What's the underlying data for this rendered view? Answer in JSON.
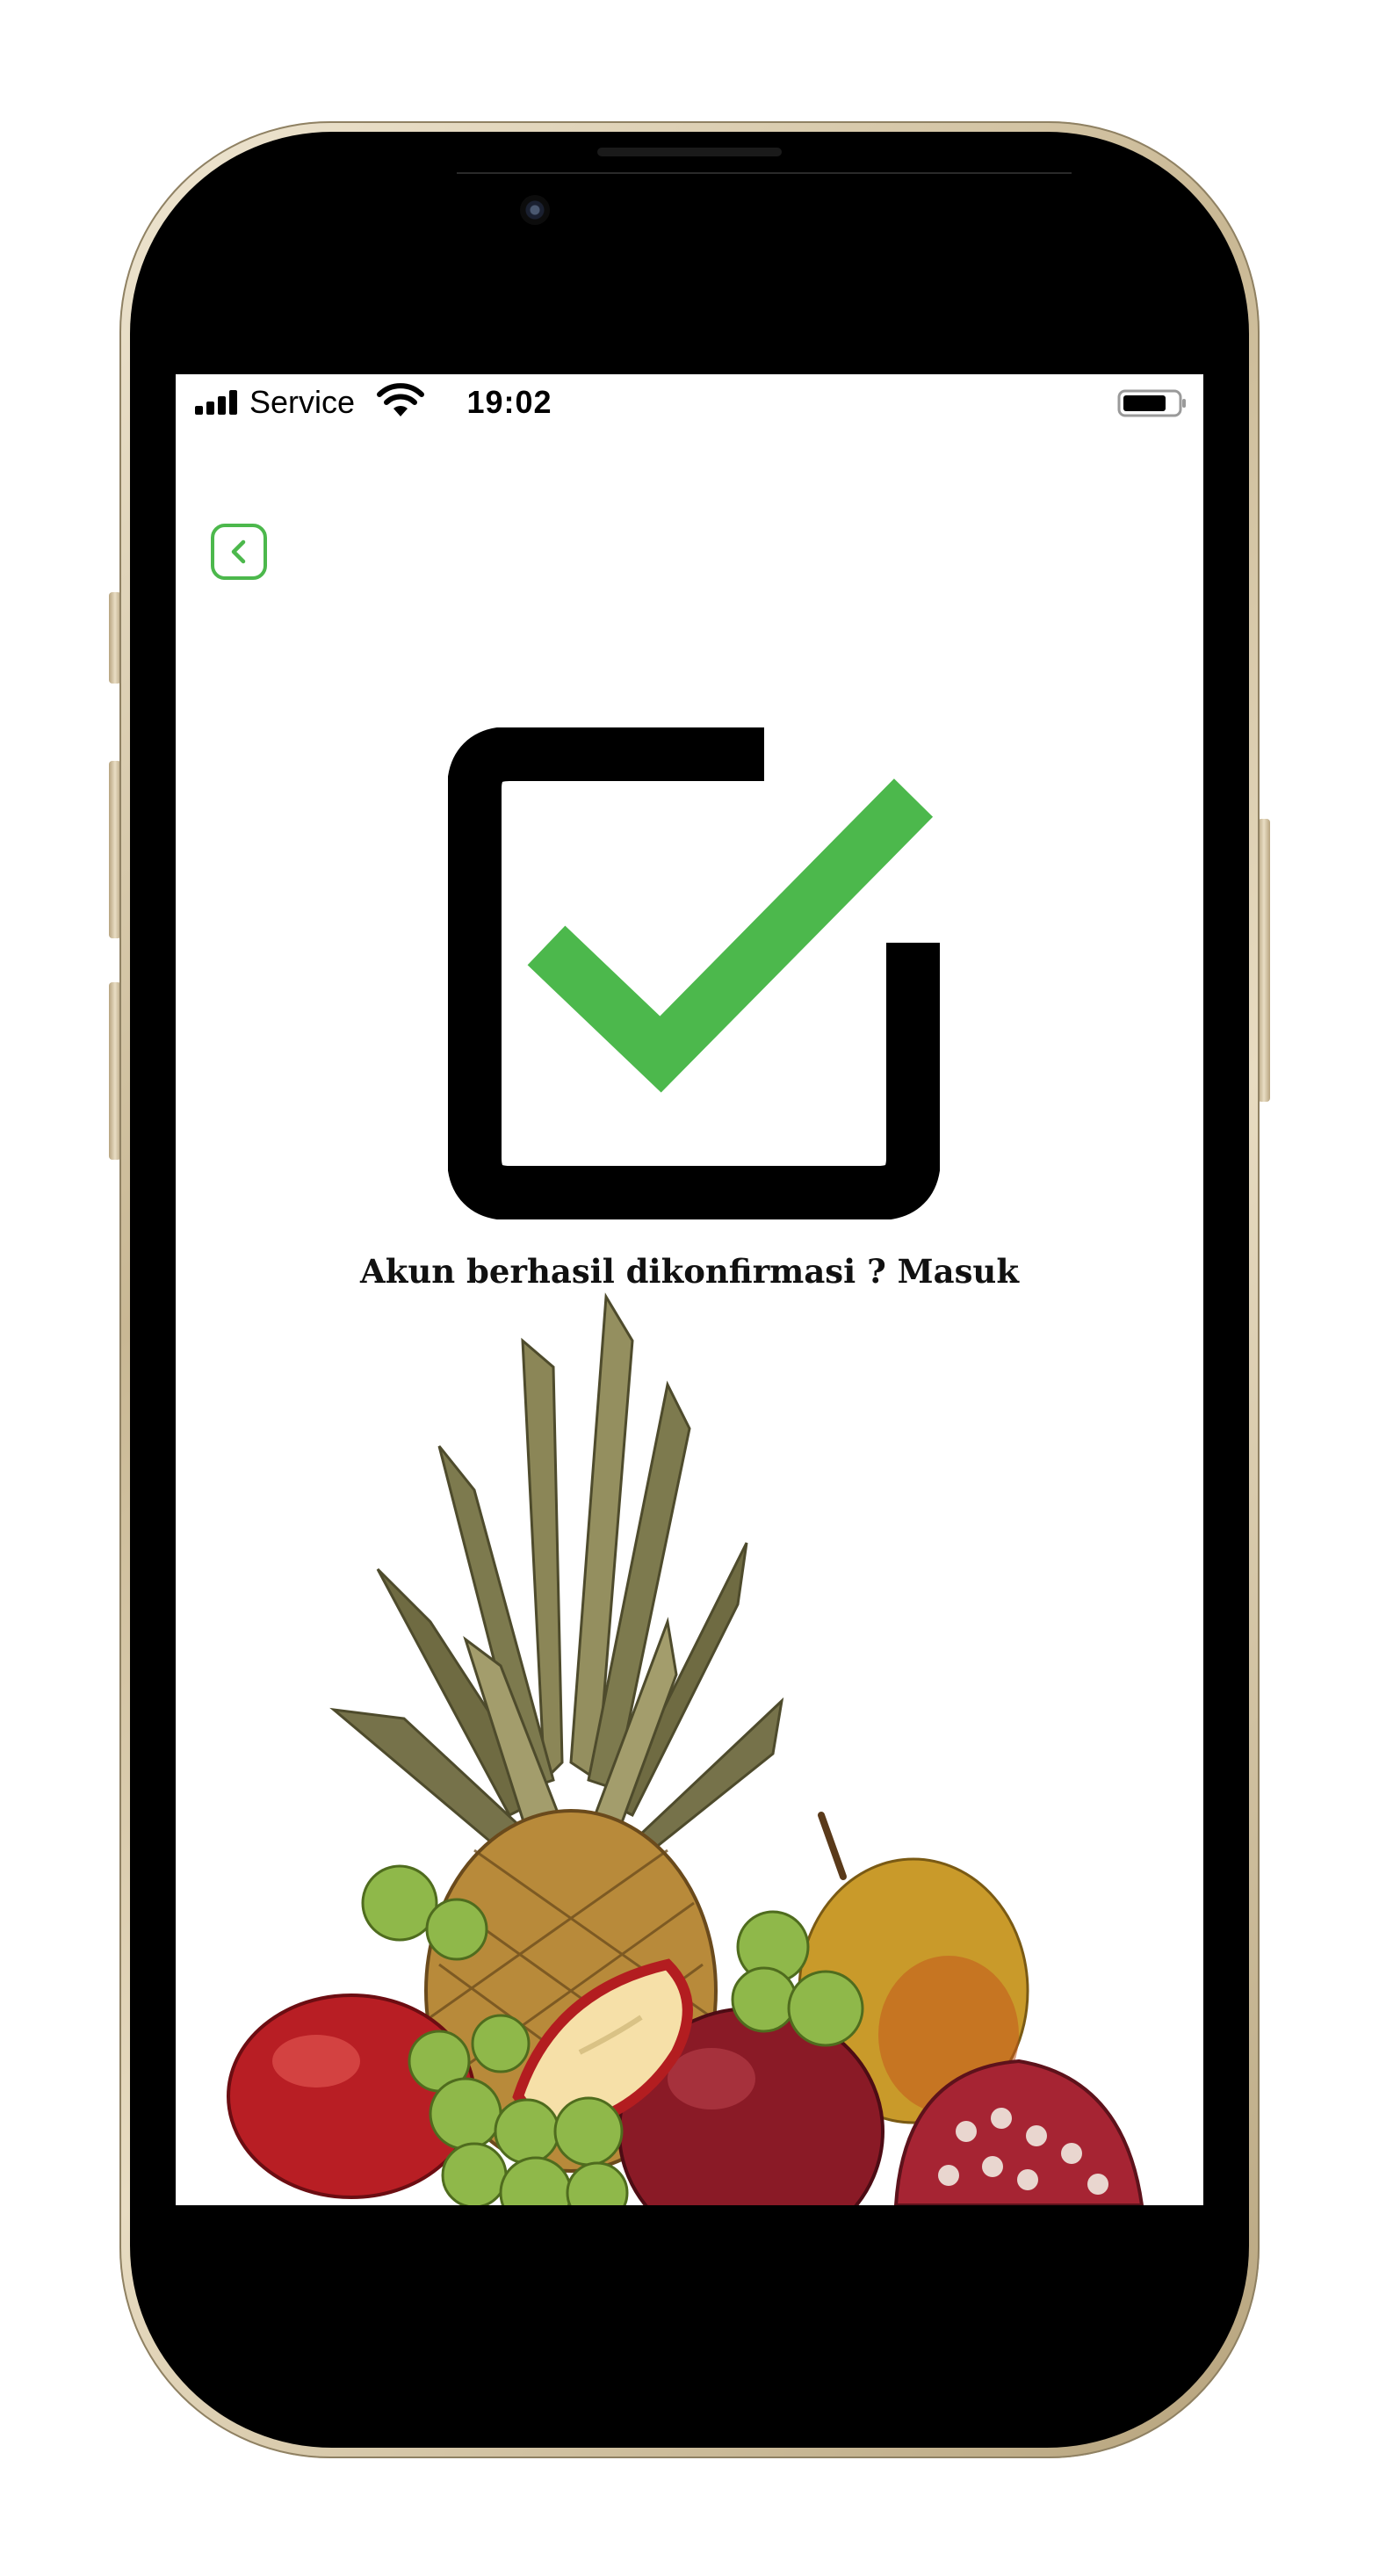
{
  "status_bar": {
    "carrier": "Service",
    "time": "19:02",
    "battery_level": 0.8
  },
  "nav": {
    "back_icon": "chevron-left-icon"
  },
  "confirmation": {
    "icon": "checkbox-check-icon",
    "message": "Akun berhasil dikonfirmasi ?",
    "login_link": "Masuk"
  },
  "hero": {
    "image": "fruit-assortment-illustration"
  },
  "colors": {
    "accent_green": "#4cb84c",
    "text": "#111111",
    "frame_gold": "#c9b894"
  }
}
